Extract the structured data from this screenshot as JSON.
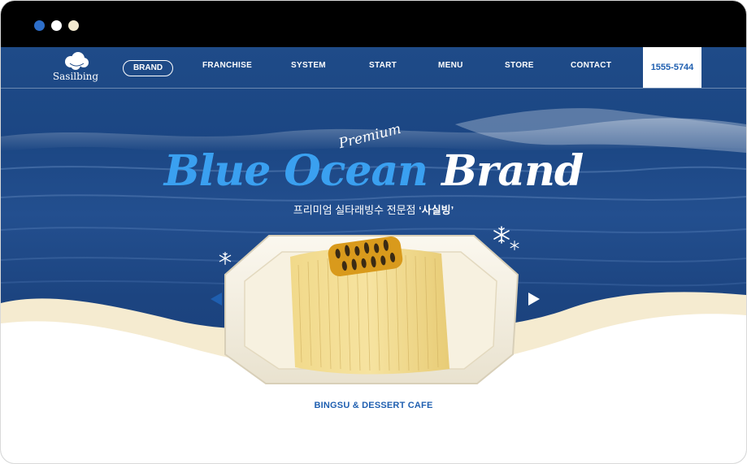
{
  "window": {
    "dots": [
      "#2d6ec9",
      "#ffffff",
      "#f3ead0"
    ]
  },
  "brand": {
    "logo_text": "Sasilbing"
  },
  "nav": {
    "items": [
      {
        "label": "BRAND"
      },
      {
        "label": "FRANCHISE"
      },
      {
        "label": "SYSTEM"
      },
      {
        "label": "START"
      },
      {
        "label": "MENU"
      },
      {
        "label": "STORE"
      },
      {
        "label": "CONTACT"
      }
    ],
    "phone": "1555-5744"
  },
  "hero": {
    "premium": "Premium",
    "headline_blue": "Blue Ocean",
    "headline_white": "Brand",
    "subtitle_prefix": "프리미엄 실타래빙수 전문점 ",
    "subtitle_highlight": "‘사실빙’",
    "tagline": "BINGSU & DESSERT CAFE"
  },
  "colors": {
    "accent": "#3aa0f0",
    "primary": "#1f5fb0",
    "sea": "#1f4b88",
    "cream": "#f5ebd0"
  },
  "icons": [
    "cloud-logo-icon",
    "snowflake-icon",
    "arrow-left-icon",
    "arrow-right-icon"
  ]
}
